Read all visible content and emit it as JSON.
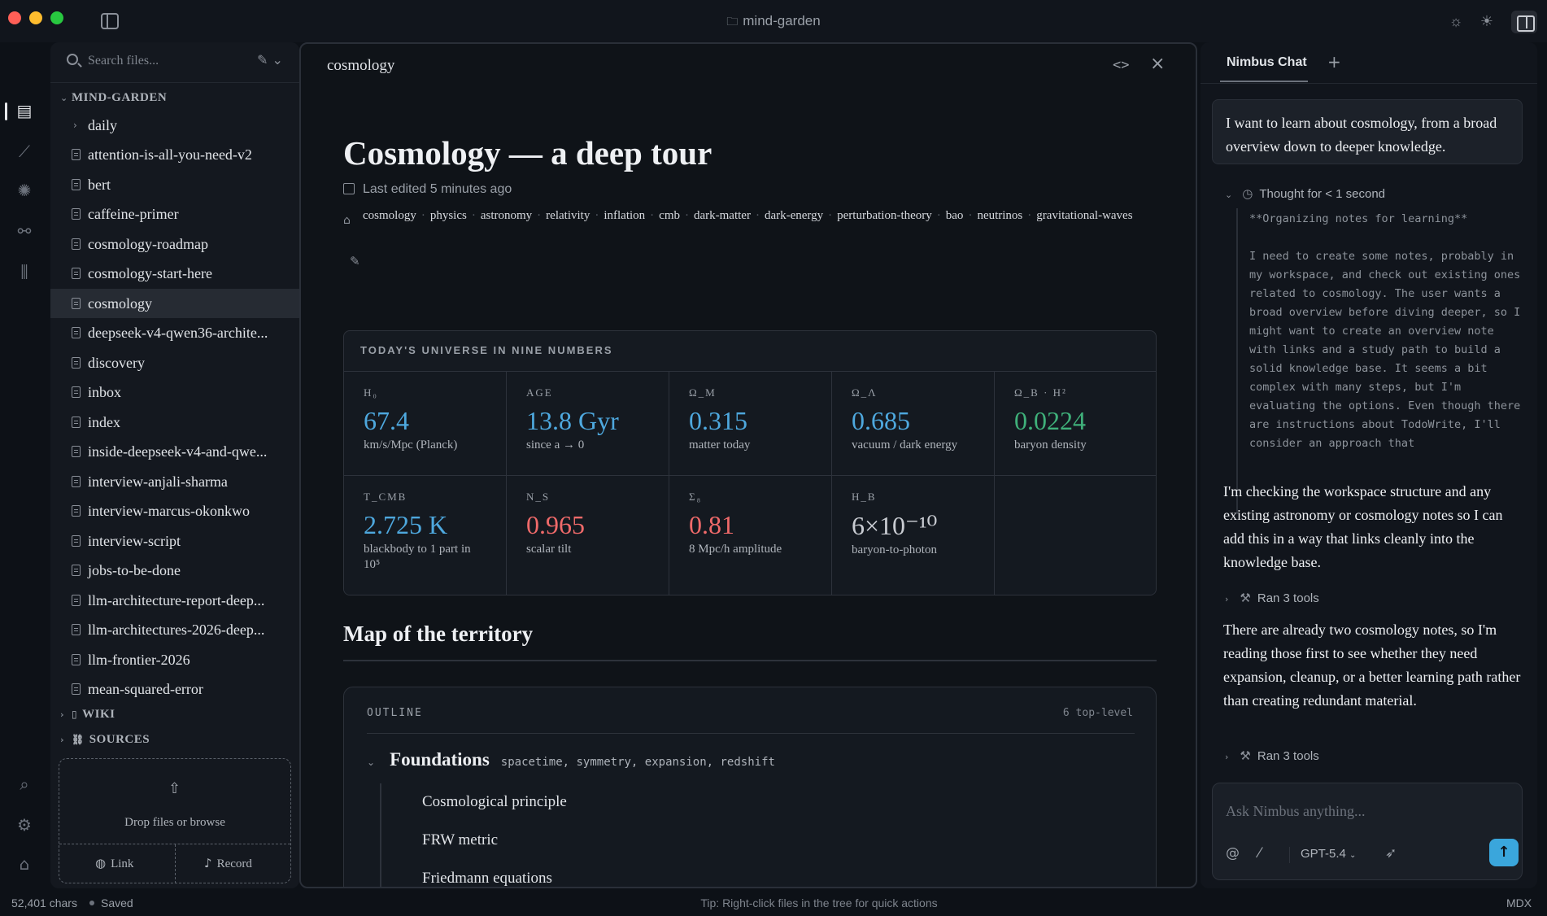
{
  "window": {
    "title": "mind-garden"
  },
  "files": {
    "search_placeholder": "Search files...",
    "root_label": "MIND-GARDEN",
    "folder_daily": "daily",
    "items": [
      "attention-is-all-you-need-v2",
      "bert",
      "caffeine-primer",
      "cosmology-roadmap",
      "cosmology-start-here",
      "cosmology",
      "deepseek-v4-qwen36-archite...",
      "discovery",
      "inbox",
      "index",
      "inside-deepseek-v4-and-qwe...",
      "interview-anjali-sharma",
      "interview-marcus-okonkwo",
      "interview-script",
      "jobs-to-be-done",
      "llm-architecture-report-deep...",
      "llm-architectures-2026-deep...",
      "llm-frontier-2026",
      "mean-squared-error"
    ],
    "active_item": "cosmology",
    "wiki_label": "WIKI",
    "sources_label": "SOURCES",
    "drop_text": "Drop files or browse",
    "link_label": "Link",
    "record_label": "Record"
  },
  "editor": {
    "tab_title": "cosmology",
    "doc_title": "Cosmology — a deep tour",
    "last_edited": "Last edited 5 minutes ago",
    "tags": [
      "cosmology",
      "physics",
      "astronomy",
      "relativity",
      "inflation",
      "cmb",
      "dark-matter",
      "dark-energy",
      "perturbation-theory",
      "bao",
      "neutrinos",
      "gravitational-waves"
    ],
    "stats_title": "TODAY'S UNIVERSE IN NINE NUMBERS",
    "stats": [
      {
        "label": "H₀",
        "value": "67.4",
        "desc": "km/s/Mpc (Planck)",
        "color": "#4ea8de"
      },
      {
        "label": "AGE",
        "value": "13.8 Gyr",
        "desc": "since a → 0",
        "color": "#4ea8de"
      },
      {
        "label": "Ω_M",
        "value": "0.315",
        "desc": "matter today",
        "color": "#4ea8de"
      },
      {
        "label": "Ω_Λ",
        "value": "0.685",
        "desc": "vacuum / dark energy",
        "color": "#4ea8de"
      },
      {
        "label": "Ω_B · H²",
        "value": "0.0224",
        "desc": "baryon density",
        "color": "#3fb07a"
      },
      {
        "label": "T_CMB",
        "value": "2.725 K",
        "desc": "blackbody to 1 part in 10⁵",
        "color": "#4ea8de"
      },
      {
        "label": "N_S",
        "value": "0.965",
        "desc": "scalar tilt",
        "color": "#f06a6a"
      },
      {
        "label": "Σ₈",
        "value": "0.81",
        "desc": "8 Mpc/h amplitude",
        "color": "#f06a6a"
      },
      {
        "label": "H_B",
        "value": "6×10⁻¹⁰",
        "desc": "baryon-to-photon",
        "color": "#c9ccd2"
      }
    ],
    "section_heading": "Map of the territory",
    "outline": {
      "label": "OUTLINE",
      "count": "6 top-level",
      "top_item": "Foundations",
      "top_keywords": "spacetime, symmetry, expansion, redshift",
      "sub_items": [
        "Cosmological principle",
        "FRW metric",
        "Friedmann equations"
      ]
    }
  },
  "chat": {
    "tab_label": "Nimbus Chat",
    "user_message": "I want to learn about cosmology, from a broad overview down to deeper knowledge.",
    "thought_label": "Thought for < 1 second",
    "thought_heading": "**Organizing notes for learning**",
    "thought_body": "I need to create some notes, probably in my workspace, and check out existing ones related to cosmology. The user wants a broad overview before diving deeper, so I might want to create an overview note with links and a study path to build a solid knowledge base. It seems a bit complex with many steps, but I'm evaluating the options. Even though there are instructions about TodoWrite, I'll consider an approach that",
    "assistant_1": "I'm checking the workspace structure and any existing astronomy or cosmology notes so I can add this in a way that links cleanly into the knowledge base.",
    "tools_1": "Ran 3 tools",
    "assistant_2": "There are already two cosmology notes, so I'm reading those first to see whether they need expansion, cleanup, or a better learning path rather than creating redundant material.",
    "tools_2": "Ran 3 tools",
    "input_placeholder": "Ask Nimbus anything...",
    "model": "GPT-5.4"
  },
  "status": {
    "chars": "52,401 chars",
    "saved": "Saved",
    "tip": "Tip: Right-click files in the tree for quick actions",
    "format": "MDX"
  }
}
